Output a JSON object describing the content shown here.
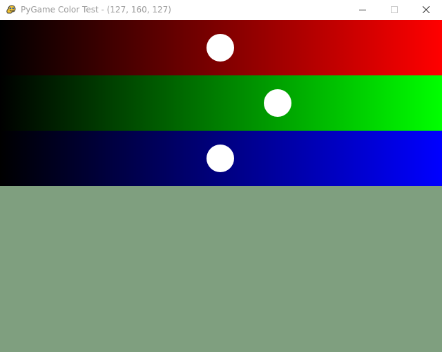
{
  "window": {
    "title": "PyGame Color Test - (127, 160, 127)",
    "icon": "pygame-snake-icon",
    "controls": {
      "minimize_icon": "minimize-icon",
      "maximize_icon": "maximize-icon",
      "close_icon": "close-icon"
    }
  },
  "color": {
    "red": 127,
    "green": 160,
    "blue": 127,
    "max": 255,
    "preview_hex": "#7f9f7f"
  },
  "sliders": [
    {
      "channel": "red",
      "value": 127,
      "end_color": "#ff0000"
    },
    {
      "channel": "green",
      "value": 160,
      "end_color": "#00ff00"
    },
    {
      "channel": "blue",
      "value": 127,
      "end_color": "#0000ff"
    }
  ]
}
